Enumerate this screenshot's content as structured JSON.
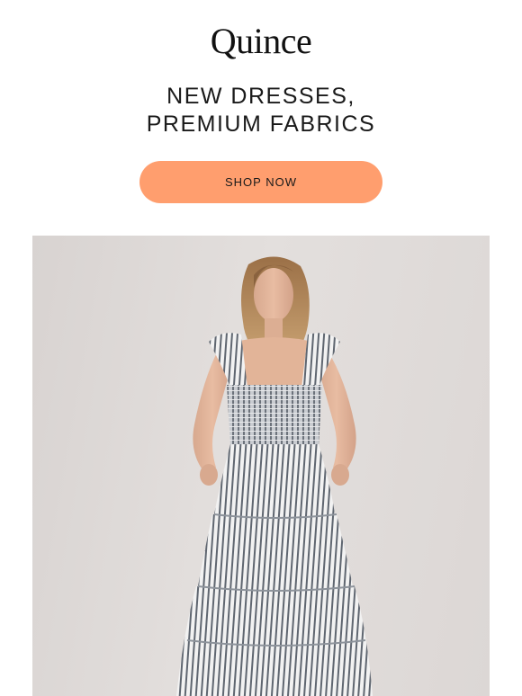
{
  "brand": {
    "logo_text": "Quince"
  },
  "headline": {
    "line1": "NEW DRESSES,",
    "line2": "PREMIUM FABRICS"
  },
  "cta": {
    "label": "SHOP NOW",
    "color": "#ff9e6e"
  },
  "hero": {
    "alt": "Model wearing a sleeveless striped tiered smocked midi dress with ruffle straps"
  }
}
